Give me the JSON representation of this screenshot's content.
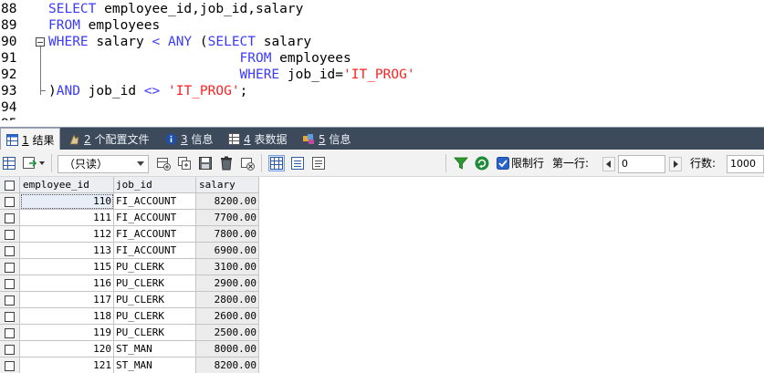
{
  "editor": {
    "lines": [
      {
        "num": "88",
        "parts": [
          {
            "t": "SELECT",
            "c": "kw"
          },
          {
            "t": " employee_id,job_id,salary",
            "c": ""
          }
        ]
      },
      {
        "num": "89",
        "parts": [
          {
            "t": "FROM",
            "c": "kw"
          },
          {
            "t": " employees",
            "c": ""
          }
        ]
      },
      {
        "num": "90",
        "parts": [
          {
            "t": "WHERE",
            "c": "kw"
          },
          {
            "t": " salary ",
            "c": ""
          },
          {
            "t": "<",
            "c": "kw"
          },
          {
            "t": " ",
            "c": ""
          },
          {
            "t": "ANY",
            "c": "kw"
          },
          {
            "t": " (",
            "c": ""
          },
          {
            "t": "SELECT",
            "c": "kw"
          },
          {
            "t": " salary",
            "c": ""
          }
        ]
      },
      {
        "num": "91",
        "parts": [
          {
            "t": "                        ",
            "c": ""
          },
          {
            "t": "FROM",
            "c": "kw"
          },
          {
            "t": " employees",
            "c": ""
          }
        ]
      },
      {
        "num": "92",
        "parts": [
          {
            "t": "                        ",
            "c": ""
          },
          {
            "t": "WHERE",
            "c": "kw"
          },
          {
            "t": " job_id=",
            "c": ""
          },
          {
            "t": "'IT_PROG'",
            "c": "str"
          }
        ]
      },
      {
        "num": "93",
        "parts": [
          {
            "t": ")",
            "c": ""
          },
          {
            "t": "AND",
            "c": "kw"
          },
          {
            "t": " job_id ",
            "c": ""
          },
          {
            "t": "<>",
            "c": "kw"
          },
          {
            "t": " ",
            "c": ""
          },
          {
            "t": "'IT_PROG'",
            "c": "str"
          },
          {
            "t": ";",
            "c": ""
          }
        ]
      },
      {
        "num": "94",
        "parts": []
      },
      {
        "num": "95",
        "parts": []
      }
    ]
  },
  "tabs": [
    {
      "num": "1",
      "label": "结果",
      "icon": "grid-icon"
    },
    {
      "num": "2",
      "label": "个配置文件",
      "icon": "profile-icon"
    },
    {
      "num": "3",
      "label": "信息",
      "icon": "info-icon"
    },
    {
      "num": "4",
      "label": "表数据",
      "icon": "table-icon"
    },
    {
      "num": "5",
      "label": "信息",
      "icon": "history-icon"
    }
  ],
  "toolbar": {
    "readonly_option": "（只读）",
    "limit_checked": true,
    "limit_label": "限制行",
    "first_row_label": "第一行:",
    "first_row_value": "0",
    "row_count_label": "行数:",
    "row_count_value": "1000",
    "colors": {
      "filter": "#2e9a2e",
      "refresh": "#1f8a3a",
      "accent": "#2a64c8"
    }
  },
  "grid": {
    "columns": [
      "employee_id",
      "job_id",
      "salary"
    ],
    "rows": [
      {
        "employee_id": "110",
        "job_id": "FI_ACCOUNT",
        "salary": "8200.00"
      },
      {
        "employee_id": "111",
        "job_id": "FI_ACCOUNT",
        "salary": "7700.00"
      },
      {
        "employee_id": "112",
        "job_id": "FI_ACCOUNT",
        "salary": "7800.00"
      },
      {
        "employee_id": "113",
        "job_id": "FI_ACCOUNT",
        "salary": "6900.00"
      },
      {
        "employee_id": "115",
        "job_id": "PU_CLERK",
        "salary": "3100.00"
      },
      {
        "employee_id": "116",
        "job_id": "PU_CLERK",
        "salary": "2900.00"
      },
      {
        "employee_id": "117",
        "job_id": "PU_CLERK",
        "salary": "2800.00"
      },
      {
        "employee_id": "118",
        "job_id": "PU_CLERK",
        "salary": "2600.00"
      },
      {
        "employee_id": "119",
        "job_id": "PU_CLERK",
        "salary": "2500.00"
      },
      {
        "employee_id": "120",
        "job_id": "ST_MAN",
        "salary": "8000.00"
      },
      {
        "employee_id": "121",
        "job_id": "ST_MAN",
        "salary": "8200.00"
      }
    ]
  }
}
